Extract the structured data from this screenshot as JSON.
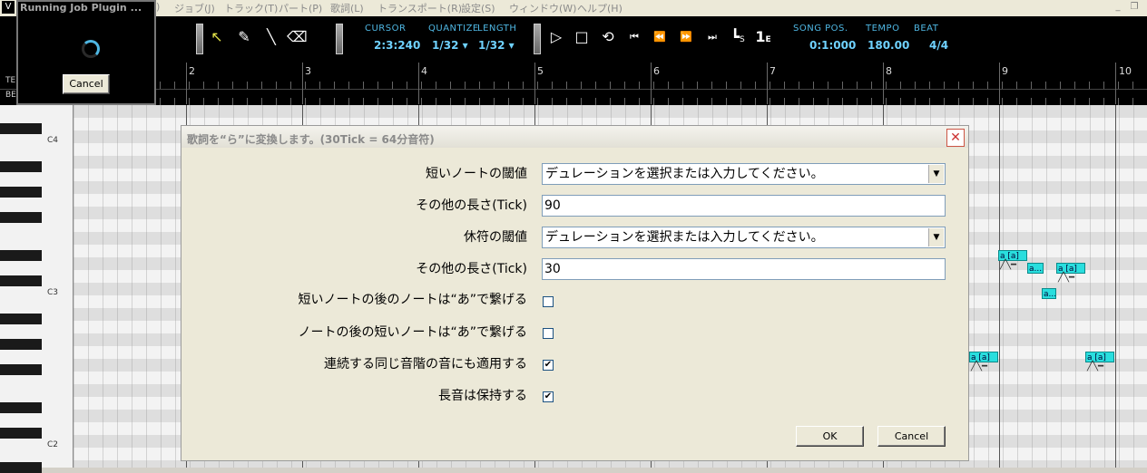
{
  "menubar": {
    "app_icon": "V",
    "items": [
      "ジョブ(J)",
      "トラック(T)",
      "パート(P)",
      "歌詞(L)",
      "トランスポート(R)",
      "設定(S)",
      "ウィンドウ(W)",
      "ヘルプ(H)"
    ],
    "partial_item": ")"
  },
  "toolbar": {
    "cursor_label": "CURSOR",
    "cursor_value": "2:3:240",
    "quantize_label": "QUANTIZE",
    "quantize_value": "1/32 ▾",
    "length_label": "LENGTH",
    "length_value": "1/32 ▾",
    "song_pos_label": "SONG POS.",
    "song_pos_value": "0:1:000",
    "tempo_label": "TEMPO",
    "tempo_value": "180.00",
    "beat_label": "BEAT",
    "beat_value": "4/4",
    "s_marker": "S",
    "e_marker": "E"
  },
  "ruler": {
    "row_labels": [
      "TE",
      "BE"
    ],
    "measures": [
      "2",
      "3",
      "4",
      "5",
      "6",
      "7",
      "8",
      "9",
      "10"
    ]
  },
  "piano": {
    "labels": [
      "C4",
      "C3",
      "C2"
    ]
  },
  "notes": {
    "lyric_a": "a [a]",
    "lyric_short": "a..."
  },
  "running_job": {
    "title": "Running Job Plugin ...",
    "cancel_label": "Cancel"
  },
  "dialog": {
    "title": "歌詞を“ら”に変換します。(30Tick = 64分音符)",
    "short_note_threshold_label": "短いノートの閾値",
    "short_note_threshold_placeholder": "デュレーションを選択または入力してください。",
    "other_length1_label": "その他の長さ(Tick)",
    "other_length1_value": "90",
    "rest_threshold_label": "休符の閾値",
    "rest_threshold_placeholder": "デュレーションを選択または入力してください。",
    "other_length2_label": "その他の長さ(Tick)",
    "other_length2_value": "30",
    "opt1_label": "短いノートの後のノートは“あ”で繋げる",
    "opt1_checked": false,
    "opt2_label": "ノートの後の短いノートは“あ”で繋げる",
    "opt2_checked": false,
    "opt3_label": "連続する同じ音階の音にも適用する",
    "opt3_checked": true,
    "opt4_label": "長音は保持する",
    "opt4_checked": true,
    "ok_label": "OK",
    "cancel_label": "Cancel"
  }
}
